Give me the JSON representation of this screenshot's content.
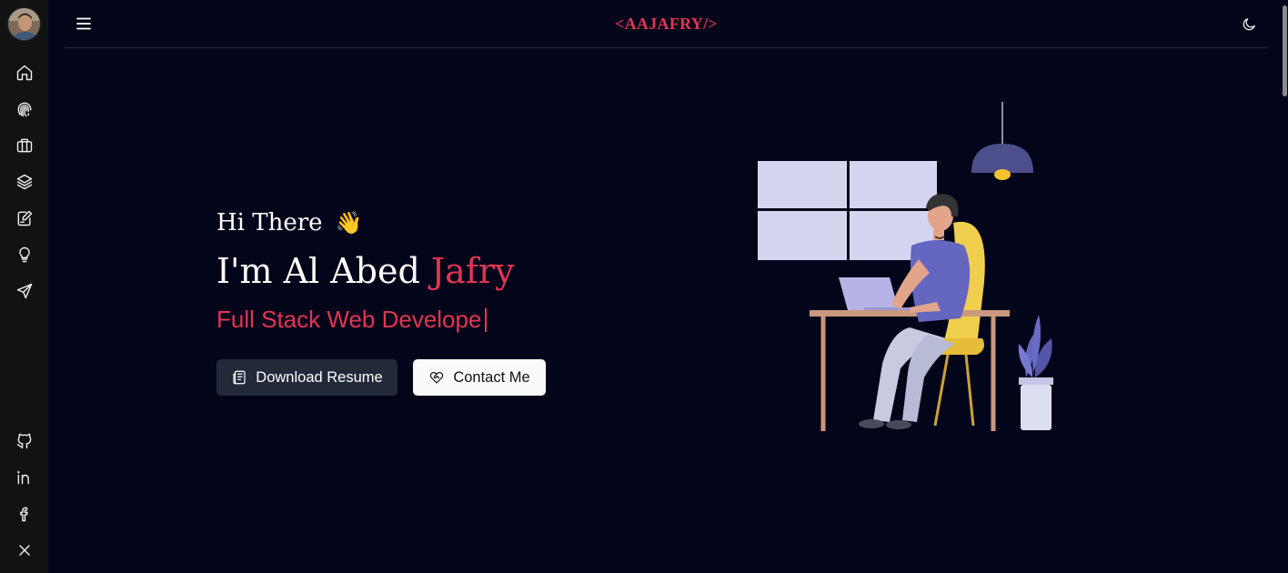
{
  "header": {
    "logo": "<AAJAFRY/>"
  },
  "hero": {
    "greeting": "Hi There",
    "wave": "👋",
    "intro_prefix": "I'm Al Abed ",
    "intro_accent": "Jafry",
    "role_typed": "Full Stack Web Develope",
    "download_resume_label": "Download Resume",
    "contact_label": "Contact Me"
  },
  "sidebar": {
    "nav_icons": [
      "home-icon",
      "fingerprint-icon",
      "briefcase-icon",
      "layers-icon",
      "edit-icon",
      "lightbulb-icon",
      "send-icon"
    ],
    "social_icons": [
      "github-icon",
      "linkedin-icon",
      "facebook-icon",
      "x-icon"
    ]
  },
  "colors": {
    "background": "#03061a",
    "sidebar": "#111214",
    "accent": "#e23553",
    "button_dark": "#222a3a",
    "button_light": "#fafafa"
  }
}
